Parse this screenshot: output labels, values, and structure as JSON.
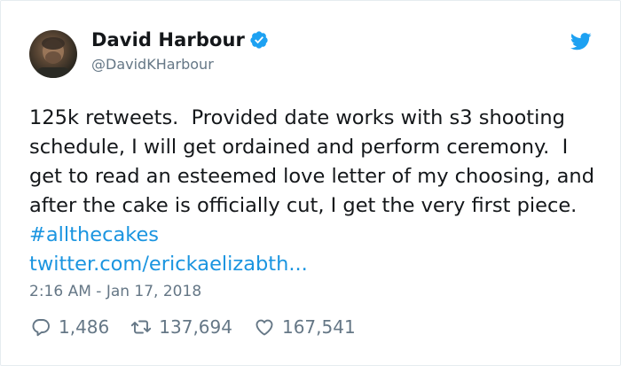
{
  "author": {
    "display_name": "David Harbour",
    "handle": "@DavidKHarbour",
    "verified": true
  },
  "tweet": {
    "text_before": "125k retweets.  Provided date works with s3 shooting schedule, I will get ordained and perform ceremony.  I get to read an esteemed love letter of my choosing, and after the cake is officially cut, I get the very first piece. ",
    "hashtag": "#allthecakes",
    "link": "twitter.com/erickaelizabth...",
    "timestamp": "2:16 AM - Jan 17, 2018"
  },
  "actions": {
    "replies": "1,486",
    "retweets": "137,694",
    "likes": "167,541"
  },
  "icons": {
    "verified": "verified-badge-icon",
    "brand": "twitter-bird-icon",
    "reply": "reply-icon",
    "retweet": "retweet-icon",
    "like": "heart-icon"
  },
  "colors": {
    "link": "#1b95e0",
    "muted": "#657786",
    "text": "#14171a",
    "brand": "#1da1f2"
  }
}
